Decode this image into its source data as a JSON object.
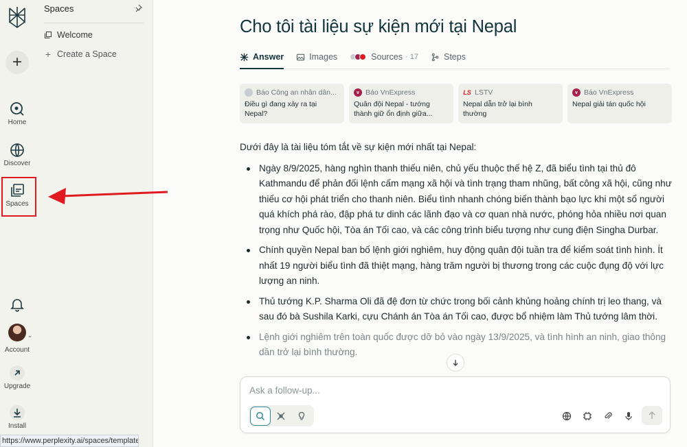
{
  "rail": {
    "home_label": "Home",
    "discover_label": "Discover",
    "spaces_label": "Spaces",
    "account_label": "Account",
    "upgrade_label": "Upgrade",
    "install_label": "Install"
  },
  "spaces_panel": {
    "title": "Spaces",
    "items": [
      {
        "label": "Welcome",
        "icon": "space-icon"
      },
      {
        "label": "Create a Space",
        "icon": "plus-icon"
      }
    ]
  },
  "thread": {
    "title": "Cho tôi tài liệu sự kiện mới tại Nepal",
    "tabs": [
      {
        "label": "Answer",
        "active": true
      },
      {
        "label": "Images"
      },
      {
        "label": "Sources",
        "count": "· 17"
      },
      {
        "label": "Steps"
      }
    ]
  },
  "sources": [
    {
      "name": "Báo Công an nhân dân...",
      "text": "Điều gì đang xảy ra tại Nepal?",
      "color": "#c9ccd0"
    },
    {
      "name": "Báo VnExpress",
      "text": "Quân đội Nepal - tướng thành giữ ổn định giữa...",
      "color": "#a4224b"
    },
    {
      "name": "LSTV",
      "text": "Nepal dẫn trở lại bình thường",
      "color": "#e0191e"
    },
    {
      "name": "Báo VnExpress",
      "text": "Nepal giải tán quốc hội",
      "color": "#a4224b"
    }
  ],
  "answer": {
    "intro": "Dưới đây là tài liệu tóm tắt về sự kiện mới nhất tại Nepal:",
    "bullets": [
      "Ngày 8/9/2025, hàng nghìn thanh thiếu niên, chủ yếu thuộc thế hệ Z, đã biểu tình tại thủ đô Kathmandu để phản đối lệnh cấm mạng xã hội và tình trạng tham nhũng, bất công xã hội, cũng như thiếu cơ hội phát triển cho thanh niên. Biểu tình nhanh chóng biến thành bạo lực khi một số người quá khích phá rào, đập phá tư dinh các lãnh đạo và cơ quan nhà nước, phóng hỏa nhiều nơi quan trọng như Quốc hội, Tòa án Tối cao, và các công trình biểu tượng như cung điện Singha Durbar.",
      "Chính quyền Nepal ban bố lệnh giới nghiêm, huy động quân đội tuần tra để kiểm soát tình hình. Ít nhất 19 người biểu tình đã thiệt mạng, hàng trăm người bị thương trong các cuộc đụng độ với lực lượng an ninh.",
      "Thủ tướng K.P. Sharma Oli đã đệ đơn từ chức trong bối cảnh khủng hoảng chính trị leo thang, và sau đó bà Sushila Karki, cựu Chánh án Tòa án Tối cao, được bổ nhiệm làm Thủ tướng lâm thời.",
      "Lệnh giới nghiêm trên toàn quốc được dỡ bỏ vào ngày 13/9/2025, và tình hình an ninh, giao thông dần trở lại bình thường."
    ]
  },
  "composer": {
    "placeholder": "Ask a follow-up..."
  },
  "status_bar": {
    "url": "https://www.perplexity.ai/spaces/templates/"
  },
  "colors": {
    "accent": "#2b8a96",
    "highlight": "#e0191e",
    "title": "#13343b"
  }
}
